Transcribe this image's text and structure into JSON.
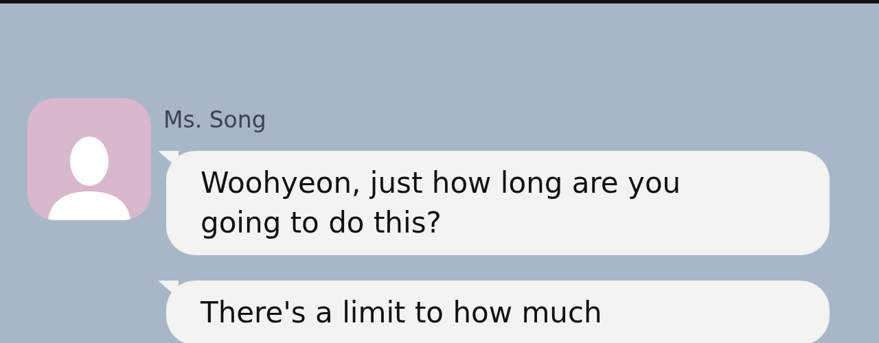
{
  "chat": {
    "sender": "Ms. Song",
    "messages": [
      {
        "text": "Woohyeon, just how long are you going to do this?"
      },
      {
        "text": "There's a limit to how much"
      }
    ]
  }
}
